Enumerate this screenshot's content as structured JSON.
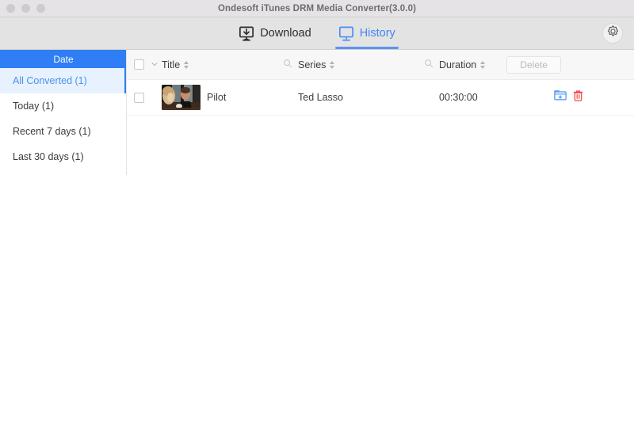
{
  "window": {
    "title": "Ondesoft iTunes DRM Media Converter(3.0.0)",
    "traffic_lights": [
      "close",
      "minimize",
      "zoom"
    ]
  },
  "toolbar": {
    "tabs": [
      {
        "label": "Download",
        "icon": "download-monitor-icon",
        "active": false
      },
      {
        "label": "History",
        "icon": "monitor-icon",
        "active": true
      }
    ],
    "settings_icon": "gear-icon",
    "accent_color": "#3f86f7"
  },
  "sidebar": {
    "header": "Date",
    "header_color": "#2f7ef5",
    "items": [
      {
        "label": "All Converted (1)",
        "selected": true
      },
      {
        "label": "Today (1)",
        "selected": false
      },
      {
        "label": "Recent 7 days (1)",
        "selected": false
      },
      {
        "label": "Last 30 days (1)",
        "selected": false
      }
    ]
  },
  "table": {
    "header": {
      "select_all_checkbox": false,
      "dropdown_icon": "chevron-down-icon",
      "columns": [
        {
          "label": "Title",
          "sortable": true
        },
        {
          "label": "Series",
          "sortable": true
        },
        {
          "label": "Duration",
          "sortable": true
        }
      ],
      "search_icons": [
        "search-icon",
        "search-icon"
      ],
      "delete_button": {
        "label": "Delete",
        "enabled": false
      }
    },
    "rows": [
      {
        "checked": false,
        "thumbnail_alt": "Ted Lasso Pilot thumbnail",
        "title": "Pilot",
        "series": "Ted Lasso",
        "duration": "00:30:00",
        "actions": [
          {
            "name": "show-in-folder-icon",
            "color": "#4a90f0"
          },
          {
            "name": "delete-icon",
            "color": "#f04b4b"
          }
        ]
      }
    ]
  }
}
